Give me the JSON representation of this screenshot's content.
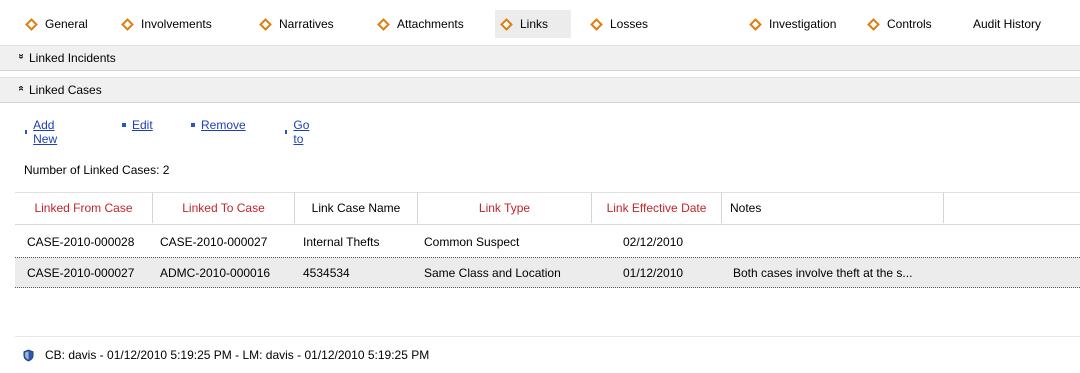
{
  "tabs": [
    {
      "label": "General",
      "icon": "diamond-icon",
      "active": false
    },
    {
      "label": "Involvements",
      "icon": "diamond-icon",
      "active": false
    },
    {
      "label": "Narratives",
      "icon": "diamond-icon",
      "active": false
    },
    {
      "label": "Attachments",
      "icon": "diamond-icon",
      "active": false
    },
    {
      "label": "Links",
      "icon": "diamond-icon",
      "active": true
    },
    {
      "label": "Losses",
      "icon": "diamond-icon",
      "active": false
    },
    {
      "label": "Investigation",
      "icon": "diamond-icon",
      "active": false
    },
    {
      "label": "Controls",
      "icon": "diamond-icon",
      "active": false
    },
    {
      "label": "Audit History",
      "icon": null,
      "active": false
    }
  ],
  "sections": {
    "linked_incidents": {
      "label": "Linked Incidents",
      "icon": "double-chevron-down-icon"
    },
    "linked_cases": {
      "label": "Linked Cases",
      "icon": "double-chevron-up-icon"
    }
  },
  "actions": {
    "add_new": "Add New",
    "edit": "Edit",
    "remove": "Remove",
    "go_to": "Go to"
  },
  "count_label": "Number of Linked Cases: 2",
  "grid": {
    "columns": [
      {
        "label": "Linked From Case",
        "highlight": true
      },
      {
        "label": "Linked To Case",
        "highlight": true
      },
      {
        "label": "Link Case Name",
        "highlight": false
      },
      {
        "label": "Link Type",
        "highlight": true
      },
      {
        "label": "Link Effective Date",
        "highlight": true
      },
      {
        "label": "Notes",
        "highlight": false
      }
    ],
    "rows": [
      {
        "from": "CASE-2010-000028",
        "to": "CASE-2010-000027",
        "name": "Internal Thefts",
        "type": "Common Suspect",
        "date": "02/12/2010",
        "notes": "",
        "selected": false
      },
      {
        "from": "CASE-2010-000027",
        "to": "ADMC-2010-000016",
        "name": "4534534",
        "type": "Same Class and Location",
        "date": "01/12/2010",
        "notes": "Both cases involve theft at the s...",
        "selected": true
      }
    ]
  },
  "footer": {
    "icon": "shield-icon",
    "text": "CB: davis - 01/12/2010 5:19:25 PM - LM: davis - 01/12/2010 5:19:25 PM"
  },
  "colors": {
    "accent_orange": "#e07d10",
    "header_red": "#c0252b",
    "link_blue": "#1d3fb8"
  }
}
